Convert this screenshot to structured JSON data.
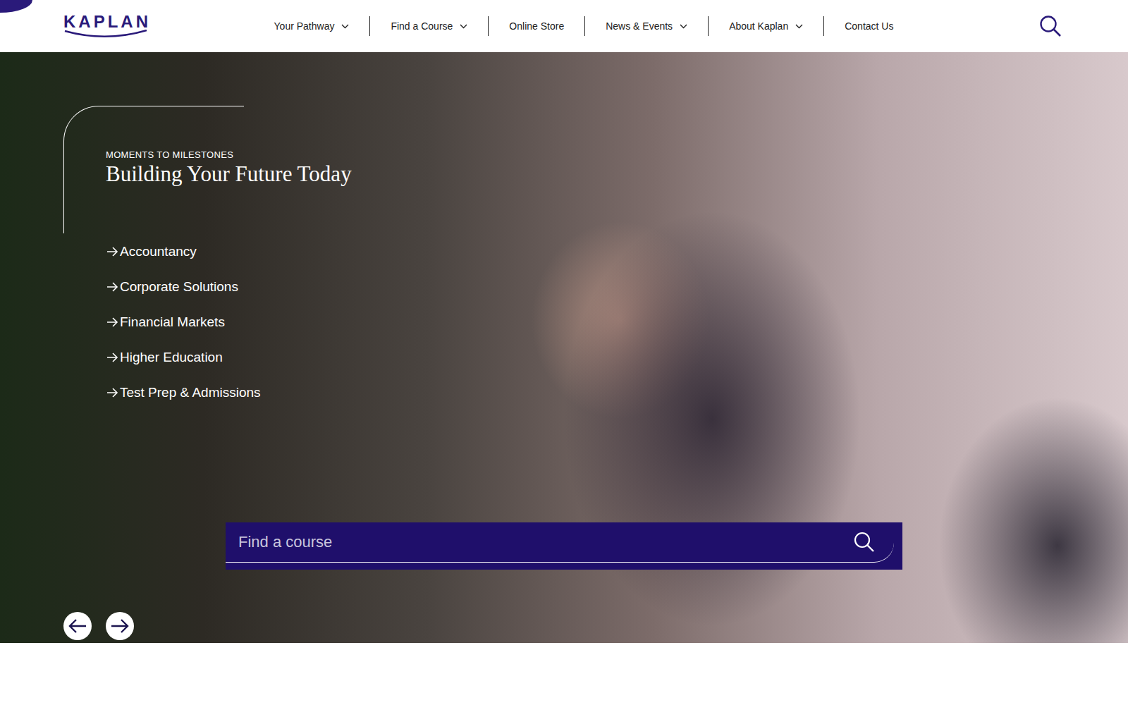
{
  "logo": {
    "text": "KAPLAN"
  },
  "nav": [
    {
      "label": "Your Pathway",
      "dropdown": true
    },
    {
      "label": "Find a Course",
      "dropdown": true
    },
    {
      "label": "Online Store",
      "dropdown": false
    },
    {
      "label": "News & Events",
      "dropdown": true
    },
    {
      "label": "About Kaplan",
      "dropdown": true
    },
    {
      "label": "Contact Us",
      "dropdown": false
    }
  ],
  "hero": {
    "eyebrow": "MOMENTS TO MILESTONES",
    "title": "Building Your Future Today",
    "links": [
      "Accountancy",
      "Corporate Solutions",
      "Financial Markets",
      "Higher Education",
      "Test Prep & Admissions"
    ]
  },
  "search": {
    "placeholder": "Find a course"
  }
}
